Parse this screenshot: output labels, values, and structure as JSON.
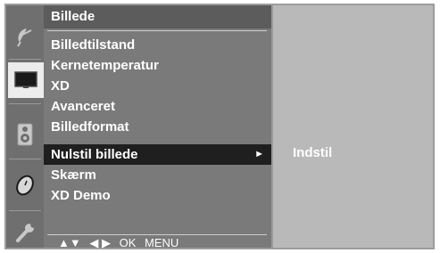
{
  "menu": {
    "title": "Billede",
    "items": [
      {
        "label": "Billedtilstand"
      },
      {
        "label": "Kernetemperatur"
      },
      {
        "label": "XD"
      },
      {
        "label": "Avanceret"
      },
      {
        "label": "Billedformat"
      },
      {
        "label": "Nulstil billede",
        "selected": true,
        "arrow": "►"
      },
      {
        "label": "Skærm"
      },
      {
        "label": "XD Demo"
      }
    ]
  },
  "submenu": {
    "items": [
      {
        "label": "Indstil"
      }
    ]
  },
  "nav_hint": {
    "updown": "▲▼",
    "leftright": "◀ ▶",
    "ok": "OK",
    "menu": "MENU"
  },
  "icons": [
    "satellite-dish-icon",
    "picture-icon",
    "speaker-icon",
    "clock-icon",
    "wrench-icon"
  ],
  "colors": {
    "panel": "#7a7a7a",
    "title_bar": "#5c5c5c",
    "selected_row": "#1f1f1f",
    "submenu_panel": "#b9b9b9",
    "text": "#ffffff"
  }
}
